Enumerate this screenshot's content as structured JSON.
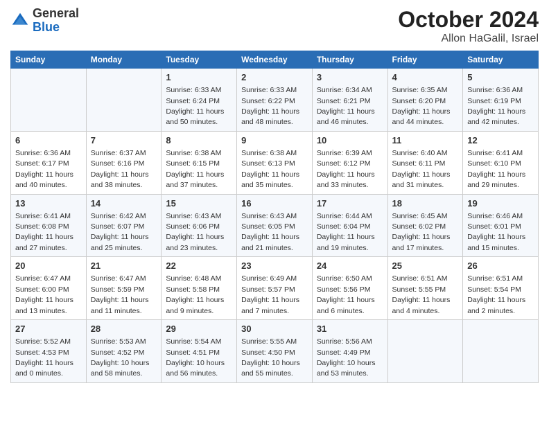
{
  "header": {
    "logo_general": "General",
    "logo_blue": "Blue",
    "month": "October 2024",
    "location": "Allon HaGalil, Israel"
  },
  "days_of_week": [
    "Sunday",
    "Monday",
    "Tuesday",
    "Wednesday",
    "Thursday",
    "Friday",
    "Saturday"
  ],
  "weeks": [
    [
      {
        "day": null
      },
      {
        "day": null
      },
      {
        "day": 1,
        "sunrise": "6:33 AM",
        "sunset": "6:24 PM",
        "daylight": "11 hours and 50 minutes."
      },
      {
        "day": 2,
        "sunrise": "6:33 AM",
        "sunset": "6:22 PM",
        "daylight": "11 hours and 48 minutes."
      },
      {
        "day": 3,
        "sunrise": "6:34 AM",
        "sunset": "6:21 PM",
        "daylight": "11 hours and 46 minutes."
      },
      {
        "day": 4,
        "sunrise": "6:35 AM",
        "sunset": "6:20 PM",
        "daylight": "11 hours and 44 minutes."
      },
      {
        "day": 5,
        "sunrise": "6:36 AM",
        "sunset": "6:19 PM",
        "daylight": "11 hours and 42 minutes."
      }
    ],
    [
      {
        "day": 6,
        "sunrise": "6:36 AM",
        "sunset": "6:17 PM",
        "daylight": "11 hours and 40 minutes."
      },
      {
        "day": 7,
        "sunrise": "6:37 AM",
        "sunset": "6:16 PM",
        "daylight": "11 hours and 38 minutes."
      },
      {
        "day": 8,
        "sunrise": "6:38 AM",
        "sunset": "6:15 PM",
        "daylight": "11 hours and 37 minutes."
      },
      {
        "day": 9,
        "sunrise": "6:38 AM",
        "sunset": "6:13 PM",
        "daylight": "11 hours and 35 minutes."
      },
      {
        "day": 10,
        "sunrise": "6:39 AM",
        "sunset": "6:12 PM",
        "daylight": "11 hours and 33 minutes."
      },
      {
        "day": 11,
        "sunrise": "6:40 AM",
        "sunset": "6:11 PM",
        "daylight": "11 hours and 31 minutes."
      },
      {
        "day": 12,
        "sunrise": "6:41 AM",
        "sunset": "6:10 PM",
        "daylight": "11 hours and 29 minutes."
      }
    ],
    [
      {
        "day": 13,
        "sunrise": "6:41 AM",
        "sunset": "6:08 PM",
        "daylight": "11 hours and 27 minutes."
      },
      {
        "day": 14,
        "sunrise": "6:42 AM",
        "sunset": "6:07 PM",
        "daylight": "11 hours and 25 minutes."
      },
      {
        "day": 15,
        "sunrise": "6:43 AM",
        "sunset": "6:06 PM",
        "daylight": "11 hours and 23 minutes."
      },
      {
        "day": 16,
        "sunrise": "6:43 AM",
        "sunset": "6:05 PM",
        "daylight": "11 hours and 21 minutes."
      },
      {
        "day": 17,
        "sunrise": "6:44 AM",
        "sunset": "6:04 PM",
        "daylight": "11 hours and 19 minutes."
      },
      {
        "day": 18,
        "sunrise": "6:45 AM",
        "sunset": "6:02 PM",
        "daylight": "11 hours and 17 minutes."
      },
      {
        "day": 19,
        "sunrise": "6:46 AM",
        "sunset": "6:01 PM",
        "daylight": "11 hours and 15 minutes."
      }
    ],
    [
      {
        "day": 20,
        "sunrise": "6:47 AM",
        "sunset": "6:00 PM",
        "daylight": "11 hours and 13 minutes."
      },
      {
        "day": 21,
        "sunrise": "6:47 AM",
        "sunset": "5:59 PM",
        "daylight": "11 hours and 11 minutes."
      },
      {
        "day": 22,
        "sunrise": "6:48 AM",
        "sunset": "5:58 PM",
        "daylight": "11 hours and 9 minutes."
      },
      {
        "day": 23,
        "sunrise": "6:49 AM",
        "sunset": "5:57 PM",
        "daylight": "11 hours and 7 minutes."
      },
      {
        "day": 24,
        "sunrise": "6:50 AM",
        "sunset": "5:56 PM",
        "daylight": "11 hours and 6 minutes."
      },
      {
        "day": 25,
        "sunrise": "6:51 AM",
        "sunset": "5:55 PM",
        "daylight": "11 hours and 4 minutes."
      },
      {
        "day": 26,
        "sunrise": "6:51 AM",
        "sunset": "5:54 PM",
        "daylight": "11 hours and 2 minutes."
      }
    ],
    [
      {
        "day": 27,
        "sunrise": "5:52 AM",
        "sunset": "4:53 PM",
        "daylight": "11 hours and 0 minutes."
      },
      {
        "day": 28,
        "sunrise": "5:53 AM",
        "sunset": "4:52 PM",
        "daylight": "10 hours and 58 minutes."
      },
      {
        "day": 29,
        "sunrise": "5:54 AM",
        "sunset": "4:51 PM",
        "daylight": "10 hours and 56 minutes."
      },
      {
        "day": 30,
        "sunrise": "5:55 AM",
        "sunset": "4:50 PM",
        "daylight": "10 hours and 55 minutes."
      },
      {
        "day": 31,
        "sunrise": "5:56 AM",
        "sunset": "4:49 PM",
        "daylight": "10 hours and 53 minutes."
      },
      {
        "day": null
      },
      {
        "day": null
      }
    ]
  ]
}
